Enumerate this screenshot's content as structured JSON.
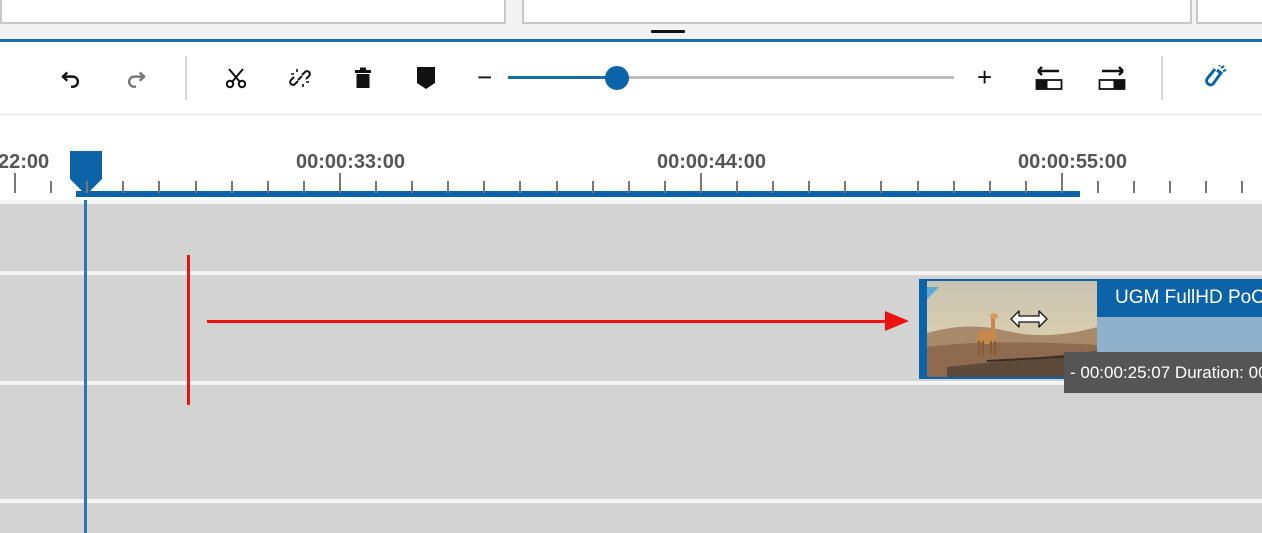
{
  "toolbar": {
    "zoom_out": "−",
    "zoom_in": "+",
    "icons": [
      "undo-icon",
      "redo-icon",
      "scissors-icon",
      "unlink-icon",
      "trash-icon",
      "marker-icon",
      "align-left-icon",
      "align-right-icon",
      "snap-magnet-icon"
    ],
    "zoom_level": 0.24
  },
  "ruler": {
    "labels": [
      "22:00",
      "00:00:33:00",
      "00:00:44:00",
      "00:00:55:00"
    ]
  },
  "clip": {
    "title": "UGM FullHD PoC",
    "tooltip": "- 00:00:25:07 Duration: 00"
  },
  "colors": {
    "accent": "#0d63a8",
    "annotation": "#ee1111"
  }
}
